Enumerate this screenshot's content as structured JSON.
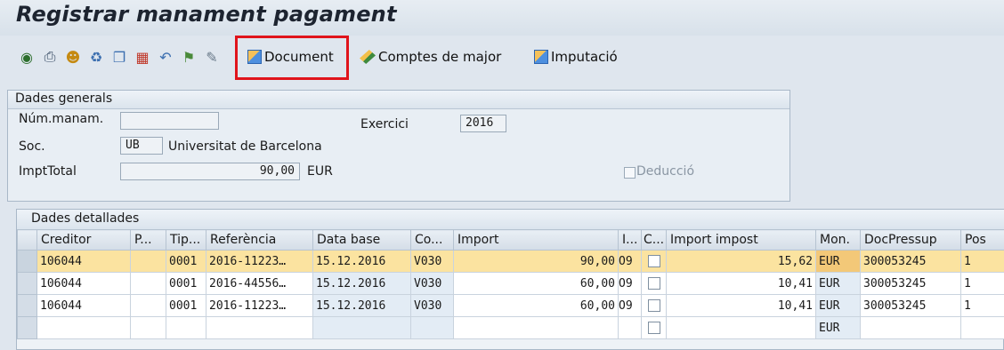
{
  "window": {
    "title": "Registrar manament pagament"
  },
  "toolbar": {
    "icons": [
      "display-change-icon",
      "print-icon",
      "user-icon",
      "delete-icon",
      "copy-icon",
      "compare-icon",
      "undo-icon",
      "notify-icon",
      "edit-icon"
    ],
    "document_label": "Document",
    "comptes_label": "Comptes de major",
    "imputacio_label": "Imputació"
  },
  "general": {
    "title": "Dades generals",
    "num_label": "Núm.manam.",
    "num_value": "",
    "exercici_label": "Exercici",
    "exercici_value": "2016",
    "soc_label": "Soc.",
    "soc_value": "UB",
    "soc_name": "Universitat de Barcelona",
    "impt_label": "ImptTotal",
    "impt_value": "90,00",
    "impt_currency": "EUR",
    "deduccio_label": "Deducció",
    "deduccio_checked": false
  },
  "details": {
    "title": "Dades detallades",
    "columns": [
      "Creditor",
      "P...",
      "Tip...",
      "Referència",
      "Data base",
      "Co...",
      "Import",
      "I...",
      "C...",
      "Import impost",
      "Mon.",
      "DocPressup",
      "Pos"
    ],
    "rows": [
      {
        "creditor": "106044",
        "p": "",
        "tip": "0001",
        "ref": "2016-11223…",
        "data": "15.12.2016",
        "co": "V030",
        "import": "90,00",
        "i": "O9",
        "c": "",
        "impost": "15,62",
        "mon": "EUR",
        "doc": "300053245",
        "pos": "1"
      },
      {
        "creditor": "106044",
        "p": "",
        "tip": "0001",
        "ref": "2016-44556…",
        "data": "15.12.2016",
        "co": "V030",
        "import": "60,00",
        "i": "O9",
        "c": "",
        "impost": "10,41",
        "mon": "EUR",
        "doc": "300053245",
        "pos": "1"
      },
      {
        "creditor": "106044",
        "p": "",
        "tip": "0001",
        "ref": "2016-11223…",
        "data": "15.12.2016",
        "co": "V030",
        "import": "60,00",
        "i": "O9",
        "c": "",
        "impost": "10,41",
        "mon": "EUR",
        "doc": "300053245",
        "pos": "1"
      },
      {
        "creditor": "",
        "p": "",
        "tip": "",
        "ref": "",
        "data": "",
        "co": "",
        "import": "",
        "i": "",
        "c": "",
        "impost": "",
        "mon": "EUR",
        "doc": "",
        "pos": ""
      }
    ]
  },
  "colors": {
    "highlight_box": "#e0141b",
    "selected_row": "#fbe3a0",
    "background": "#dfe6ee"
  }
}
